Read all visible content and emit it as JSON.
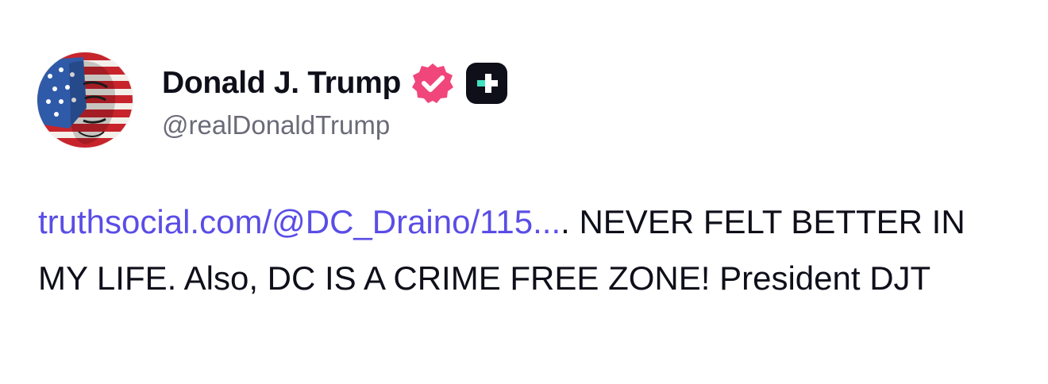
{
  "author": {
    "display_name": "Donald J. Trump",
    "handle": "@realDonaldTrump",
    "avatar_icon": "flag-portrait-avatar",
    "verified_icon": "verified-badge-icon",
    "verified_color": "#f0467c",
    "plus_icon": "truth-plus-badge-icon",
    "plus_badge_color": "#0f0f1a",
    "plus_accent_color": "#40e0c0"
  },
  "post": {
    "link_text": "truthsocial.com/@DC_Draino/115...",
    "link_color": "#5a4de6",
    "text_after_link": ". NEVER FELT BETTER IN MY LIFE. Also, DC IS A CRIME FREE ZONE! President DJT"
  }
}
